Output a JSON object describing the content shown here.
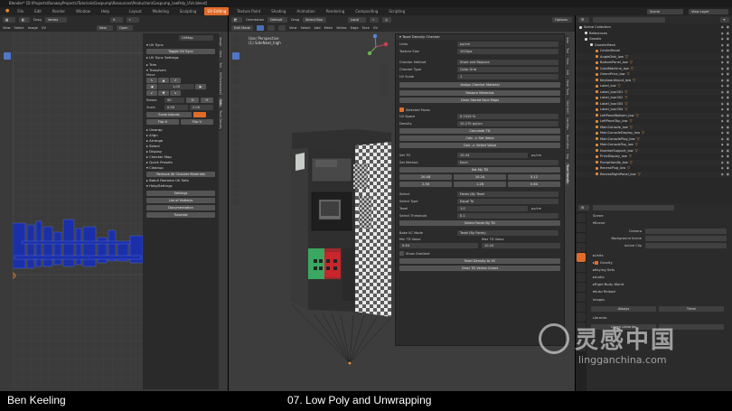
{
  "window_title": "Blender* [D:\\Projects\\RunwayProjects\\Tutorials\\Gaspump\\Resources\\Production\\Gaspump_lowPoly_UVs.blend]",
  "menu": [
    "File",
    "Edit",
    "Render",
    "Window",
    "Help"
  ],
  "workspaces": [
    "Layout",
    "Modeling",
    "Sculpting",
    "UV Editing",
    "Texture Paint",
    "Shading",
    "Animation",
    "Rendering",
    "Compositing",
    "Scripting"
  ],
  "workspace_active": "UV Editing",
  "scene_label": "Scene",
  "viewlayer_label": "View Layer",
  "uv_editor": {
    "header": {
      "mode": "UV Editor",
      "drag": "Drag",
      "snap": "Vertex",
      "view": "View",
      "select": "Select",
      "image": "Image",
      "uv": "UV",
      "new": "New",
      "open": "Open",
      "uvmap": "UVMap"
    },
    "tabs": [
      "Image",
      "View",
      "Tool",
      "UVPackmaster2",
      "Sets",
      "Texel Density"
    ],
    "panels": {
      "uvsync_title": "UV Sync",
      "uvsync_btn": "Toggle UV Sync",
      "uvsync_settings": "UV Sync Settings",
      "trim": "Trim",
      "transform": "Transform",
      "move": "Move",
      "move_value": "1.00",
      "rotate_label": "Rotate",
      "rotate_value": "90",
      "rotate_btn": "90",
      "scale_label": "Scale",
      "scale_x": "0.50",
      "scale_y": "2.00",
      "scale_btn": "Scale Islands",
      "flip_h": "Flip H",
      "flip_v": "Flip V",
      "unwrap": "Unwrap",
      "align": "Align",
      "arrange": "Arrange",
      "select": "Select",
      "display": "Display",
      "checker_map": "Checker Map",
      "quick_presets": "Quick Presets",
      "cleanup": "Cleanup",
      "remove_checker": "Remove All Checker Materials",
      "batch_rename": "Batch Rename UV Sets",
      "help": "Help/Settings",
      "settings_btn": "Settings",
      "hotkeys_btn": "List of Hotkeys",
      "docs_btn": "Documentation",
      "tutorials_btn": "Tutorials"
    }
  },
  "viewport": {
    "header": {
      "mode": "Edit Mode",
      "view": "View",
      "select": "Select",
      "add": "Add",
      "mesh": "Mesh",
      "vertex": "Vertex",
      "edge": "Edge",
      "face": "Face",
      "uv": "UV",
      "orientation": "Orientation",
      "default": "Default",
      "drag": "Drag",
      "select_box": "Select Box",
      "pivot": "Local",
      "options": "Options"
    },
    "overlay_line1": "User Perspective",
    "overlay_line2": "(1) SideNeat_high",
    "tabs": [
      "Item",
      "Tool",
      "View",
      "Edit",
      "Mesh Tools",
      "MACHIN3",
      "HardOps",
      "BoxCutter",
      "Hop",
      "Texel Density"
    ]
  },
  "texel_panel": {
    "title": "Texel Density Checker",
    "units_label": "Units",
    "units_value": "px/cm",
    "texture_size_label": "Texture Size",
    "texture_size_value": "1024px",
    "checker_method_label": "Checker Method",
    "checker_method_value": "Store and Replace",
    "checker_type_label": "Checker Type",
    "checker_type_value": "Color Grid",
    "uv_scale_label": "UV Scale",
    "uv_scale_value": "1",
    "assign_btn": "Assign Checker Material",
    "restore_btn": "Restore Materials",
    "clear_btn": "Clear Stored Face Maps",
    "selected_faces": "Selected Faces",
    "uv_space_label": "UV Space",
    "uv_space_value": "0.7419 %",
    "density_label": "Density",
    "density_value": "10.170 px/cm",
    "calc_btn": "Calculate TD",
    "calc_to_uv": "Calc -> Set Value",
    "calc_to_select": "Calc -> Select Value",
    "set_td_label": "Set TD",
    "set_td_value": "10.24",
    "set_td_unit": "px/cm",
    "set_method_label": "Set Method",
    "set_method_value": "Each",
    "set_my_td": "Set My TD",
    "presets_row1": [
      "20.48",
      "10.24",
      "5.12"
    ],
    "presets_row2": [
      "2.56",
      "1.28",
      "0.64"
    ],
    "select_label": "Select",
    "select_value": "Faces (By Texel",
    "select_type_label": "Select Type",
    "select_type_value": "Equal To",
    "texel_label": "Texel",
    "texel_value": "1.0",
    "texel_unit": "px/cm",
    "threshold_label": "Select Threshold",
    "threshold_value": "0.1",
    "select_faces_btn": "Select Faces By TD",
    "bake_label": "Bake VC Mode",
    "bake_value": "Texel (By Faces)",
    "min_td_label": "Min TD Value",
    "max_td_label": "Max TD Value",
    "min_td_value": "0.64",
    "max_td_value": "10.24",
    "show_gradient": "Show Gradient",
    "texel_to_vc": "Texel Density to VC",
    "clear_vc": "Clear TD Vertex Colors"
  },
  "outliner": {
    "header": "Scene Collection",
    "items": [
      {
        "name": "Scene Collection",
        "indent": 0
      },
      {
        "name": "References",
        "indent": 1
      },
      {
        "name": "Gnostic",
        "indent": 1
      },
      {
        "name": "GnosticMesh",
        "indent": 2
      },
      {
        "name": "CenterBevel",
        "indent": 3
      },
      {
        "name": "AngleDisk_low",
        "indent": 3
      },
      {
        "name": "BottomPanel_low",
        "indent": 3
      },
      {
        "name": "CashMachine_low",
        "indent": 3
      },
      {
        "name": "GreenPrice_low",
        "indent": 3
      },
      {
        "name": "KeyboardInput_low",
        "indent": 3
      },
      {
        "name": "Label_low",
        "indent": 3
      },
      {
        "name": "Label_low.001",
        "indent": 3
      },
      {
        "name": "Label_low.002",
        "indent": 3
      },
      {
        "name": "Label_low.003",
        "indent": 3
      },
      {
        "name": "Label_low.004",
        "indent": 3
      },
      {
        "name": "LeftPanelBottom_low",
        "indent": 3
      },
      {
        "name": "LeftPanelTop_low",
        "indent": 3
      },
      {
        "name": "MainConsole_low",
        "indent": 3
      },
      {
        "name": "MainConsoleDisplay_low",
        "indent": 3
      },
      {
        "name": "MainConsolePlug_low",
        "indent": 3
      },
      {
        "name": "MainConsoleTop_low",
        "indent": 3
      },
      {
        "name": "NumberSupport_low",
        "indent": 3
      },
      {
        "name": "PriceDisplay_low",
        "indent": 3
      },
      {
        "name": "PumpHandle_low",
        "indent": 3
      },
      {
        "name": "RecessPlug_low",
        "indent": 3
      },
      {
        "name": "RecessRightPanel_low",
        "indent": 3
      }
    ]
  },
  "properties": {
    "scene": "Scene",
    "scene_section": "Scene",
    "camera_label": "Camera",
    "background_label": "Background Scene",
    "active_clip_label": "Active Clip",
    "units": "Units",
    "gravity": "Gravity",
    "keying_sets": "Keying Sets",
    "audio": "Audio",
    "rigid_body": "Rigid Body World",
    "auto_reload": "Auto Reload",
    "images": "Images",
    "always": "Always",
    "timer": "Timer",
    "libraries": "Libraries",
    "check_libs": "Check Libraries"
  },
  "caption": {
    "left": "Ben Keeling",
    "center": "07. Low Poly and Unwrapping"
  },
  "watermark": {
    "cn": "灵感中国",
    "url": "lingganchina.com"
  },
  "colors": {
    "accent": "#e06c2a",
    "uv_blue": "#1a2fa8",
    "select_blue": "#4772b3",
    "green": "#3aa860",
    "red": "#c8262c"
  }
}
